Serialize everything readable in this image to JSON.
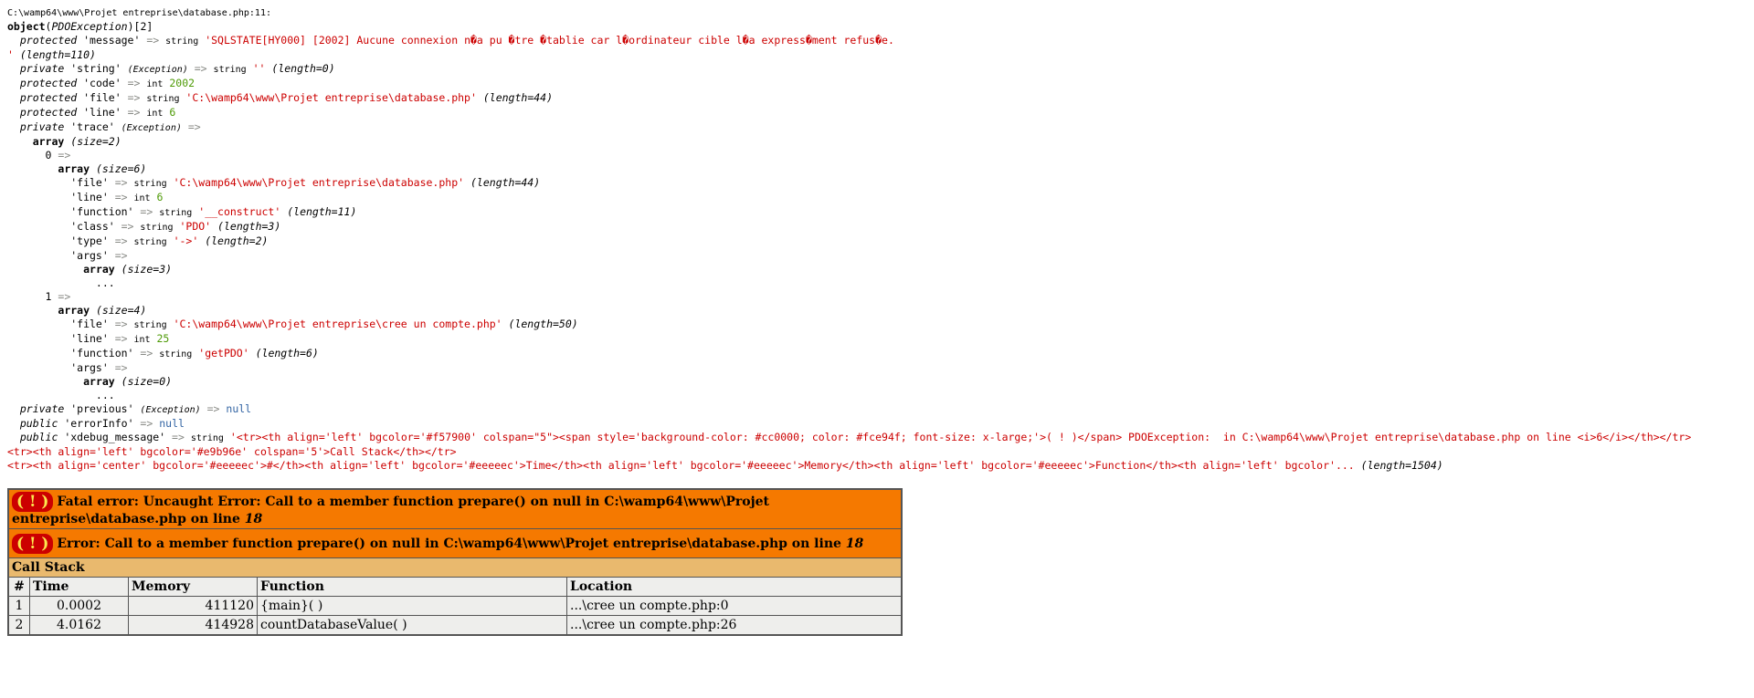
{
  "dump": {
    "location": "C:\\wamp64\\www\\Projet entreprise\\database.php:11:",
    "object_type": "PDOException",
    "object_count": "[2]",
    "message_value": "'SQLSTATE[HY000] [2002] Aucune connexion n�a pu �tre �tablie car l�ordinateur cible l�a express�ment refus�e.",
    "message_length": "(length=110)",
    "code_value": "2002",
    "file_value": "'C:\\wamp64\\www\\Projet entreprise\\database.php'",
    "file_length": "(length=44)",
    "line_value": "6",
    "trace_size": "(size=2)",
    "t0_size": "(size=6)",
    "t0_file": "'C:\\wamp64\\www\\Projet entreprise\\database.php'",
    "t0_file_len": "(length=44)",
    "t0_line": "6",
    "t0_function": "'__construct'",
    "t0_function_len": "(length=11)",
    "t0_class": "'PDO'",
    "t0_class_len": "(length=3)",
    "t0_type": "'->'",
    "t0_type_len": "(length=2)",
    "t0_args_size": "(size=3)",
    "t1_size": "(size=4)",
    "t1_file": "'C:\\wamp64\\www\\Projet entreprise\\cree un compte.php'",
    "t1_file_len": "(length=50)",
    "t1_line": "25",
    "t1_function": "'getPDO'",
    "t1_function_len": "(length=6)",
    "t1_args_size": "(size=0)",
    "xdebug_line1": "'<tr><th align='left' bgcolor='#f57900' colspan=\"5\"><span style='background-color: #cc0000; color: #fce94f; font-size: x-large;'>( ! )</span> PDOException:  in C:\\wamp64\\www\\Projet entreprise\\database.php on line <i>6</i></th></tr>",
    "xdebug_line2": "<tr><th align='left' bgcolor='#e9b96e' colspan='5'>Call Stack</th></tr>",
    "xdebug_line3": "<tr><th align='center' bgcolor='#eeeeec'>#</th><th align='left' bgcolor='#eeeeec'>Time</th><th align='left' bgcolor='#eeeeec'>Memory</th><th align='left' bgcolor='#eeeeec'>Function</th><th align='left' bgcolor'...",
    "xdebug_length": "(length=1504)"
  },
  "errors": {
    "bang": "( ! )",
    "fatal_text": "Fatal error: Uncaught Error: Call to a member function prepare() on null in C:\\wamp64\\www\\Projet entreprise\\database.php on line ",
    "fatal_line": "18",
    "error_text": "Error: Call to a member function prepare() on null in C:\\wamp64\\www\\Projet entreprise\\database.php on line ",
    "error_line": "18",
    "call_stack_label": "Call Stack",
    "headers": [
      "#",
      "Time",
      "Memory",
      "Function",
      "Location"
    ],
    "rows": [
      {
        "num": "1",
        "time": "0.0002",
        "memory": "411120",
        "function": "{main}( )",
        "location": "...\\cree un compte.php:0"
      },
      {
        "num": "2",
        "time": "4.0162",
        "memory": "414928",
        "function": "countDatabaseValue( )",
        "location": "...\\cree un compte.php:26"
      }
    ]
  },
  "colors": {
    "error_orange": "#f57900",
    "call_stack_tan": "#e9b96e",
    "header_grey": "#eeeeec",
    "bang_red": "#cc0000",
    "bang_yellow": "#fce94f"
  }
}
